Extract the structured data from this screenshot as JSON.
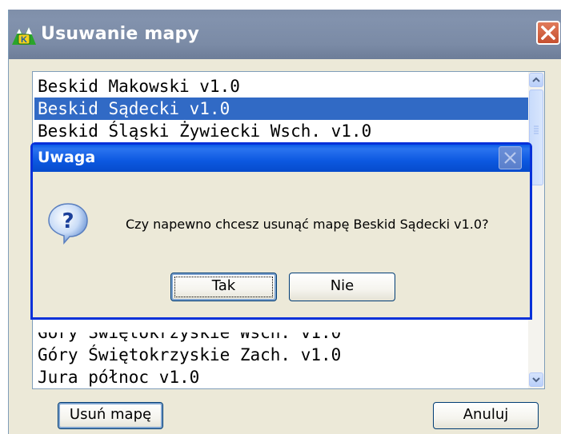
{
  "window": {
    "title": "Usuwanie mapy",
    "app_icon": "k-mountain-logo-icon",
    "close_icon": "close-icon"
  },
  "map_list": {
    "items": [
      {
        "label": "Beskid Makowski v1.0",
        "selected": false
      },
      {
        "label": "Beskid Sądecki v1.0",
        "selected": true
      },
      {
        "label": "Beskid Śląski Żywiecki Wsch. v1.0",
        "selected": false
      },
      {
        "label": "Góry Świętokrzyskie Wsch. v1.0",
        "selected": false
      },
      {
        "label": "Góry Świętokrzyskie Zach. v1.0",
        "selected": false
      },
      {
        "label": "Jura północ v1.0",
        "selected": false
      }
    ],
    "selection_color": "#316ac5"
  },
  "buttons": {
    "remove_map": "Usuń mapę",
    "cancel": "Anuluj"
  },
  "dialog": {
    "title": "Uwaga",
    "icon": "question-icon",
    "message": "Czy napewno chcesz usunąć mapę Beskid Sądecki v1.0?",
    "yes": "Tak",
    "no": "Nie",
    "titlebar_color": "#0a5ce6"
  }
}
